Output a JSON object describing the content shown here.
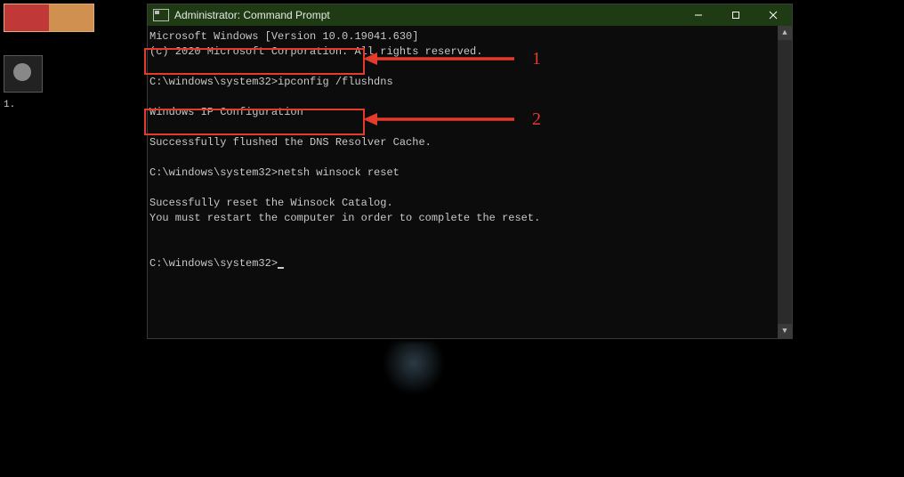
{
  "sidebar": {
    "marker": "1."
  },
  "window": {
    "title": "Administrator: Command Prompt",
    "minimize_label": "Minimize",
    "maximize_label": "Maximize",
    "close_label": "Close"
  },
  "scrollbar": {
    "up": "▲",
    "down": "▼"
  },
  "terminal": {
    "line1": "Microsoft Windows [Version 10.0.19041.630]",
    "line2": "(c) 2020 Microsoft Corporation. All rights reserved.",
    "blank": "",
    "cmd1_prompt": "C:\\windows\\system32>",
    "cmd1_text": "ipconfig /flushdns",
    "line4": "Windows IP Configuration",
    "line5": "Successfully flushed the DNS Resolver Cache.",
    "cmd2_prompt": "C:\\windows\\system32>",
    "cmd2_text": "netsh winsock reset",
    "line6": "Sucessfully reset the Winsock Catalog.",
    "line7": "You must restart the computer in order to complete the reset.",
    "cmd3_prompt": "C:\\windows\\system32>"
  },
  "annotations": {
    "num1": "1",
    "num2": "2"
  }
}
